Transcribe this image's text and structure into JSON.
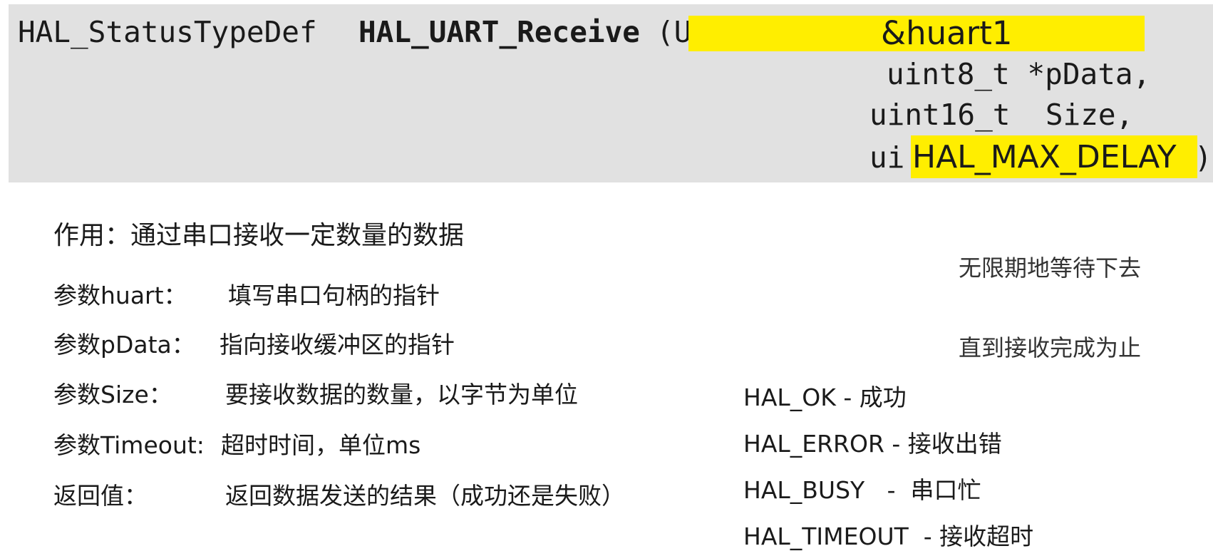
{
  "code": {
    "return_type": "HAL_StatusTypeDef",
    "function_name": "HAL_UART_Receive",
    "open_paren_fragment": "(U",
    "arg1_highlight": "&huart1",
    "arg2": "uint8_t *pData,",
    "arg3": "uint16_t  Size,",
    "arg4_prefix": "ui",
    "arg4_highlight": "HAL_MAX_DELAY",
    "close_paren": ")"
  },
  "note": {
    "line1": "无限期地等待下去",
    "line2": "直到接收完成为止"
  },
  "description": "作用：通过串口接收一定数量的数据",
  "params": [
    {
      "label": "参数huart：",
      "value": "填写串口句柄的指针"
    },
    {
      "label": "参数pData：",
      "value": "指向接收缓冲区的指针"
    },
    {
      "label": "参数Size：",
      "value": "要接收数据的数量，以字节为单位"
    },
    {
      "label": "参数Timeout:",
      "value": "超时时间，单位ms"
    },
    {
      "label": "返回值：",
      "value": "返回数据发送的结果（成功还是失败）"
    }
  ],
  "return_values": [
    "HAL_OK - 成功",
    "HAL_ERROR - 接收出错",
    "HAL_BUSY   -  串口忙",
    "HAL_TIMEOUT  - 接收超时"
  ],
  "colors": {
    "code_background": "#e1e1e1",
    "highlight": "#ffee00"
  }
}
